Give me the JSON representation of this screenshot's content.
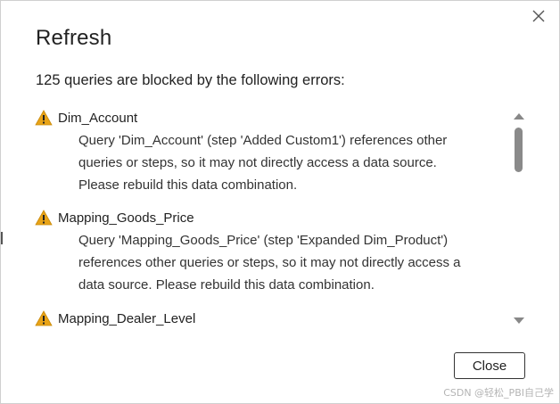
{
  "dialog": {
    "title": "Refresh",
    "summary": "125 queries are blocked by the following errors:",
    "close_label": "Close"
  },
  "errors": [
    {
      "name": "Dim_Account",
      "message_lines": [
        "Query 'Dim_Account' (step 'Added Custom1') references other",
        "queries or steps, so it may not directly access a data source.",
        "Please rebuild this data combination."
      ]
    },
    {
      "name": "Mapping_Goods_Price",
      "message_lines": [
        "Query 'Mapping_Goods_Price' (step 'Expanded Dim_Product')",
        "references other queries or steps, so it may not directly access a",
        "data source. Please rebuild this data combination."
      ]
    },
    {
      "name": "Mapping_Dealer_Level",
      "message_lines": []
    }
  ],
  "icons": {
    "warning": "warning-icon",
    "close": "close-icon",
    "warning_color": "#E8A317"
  },
  "watermark": "CSDN @轻松_PBI自己学"
}
